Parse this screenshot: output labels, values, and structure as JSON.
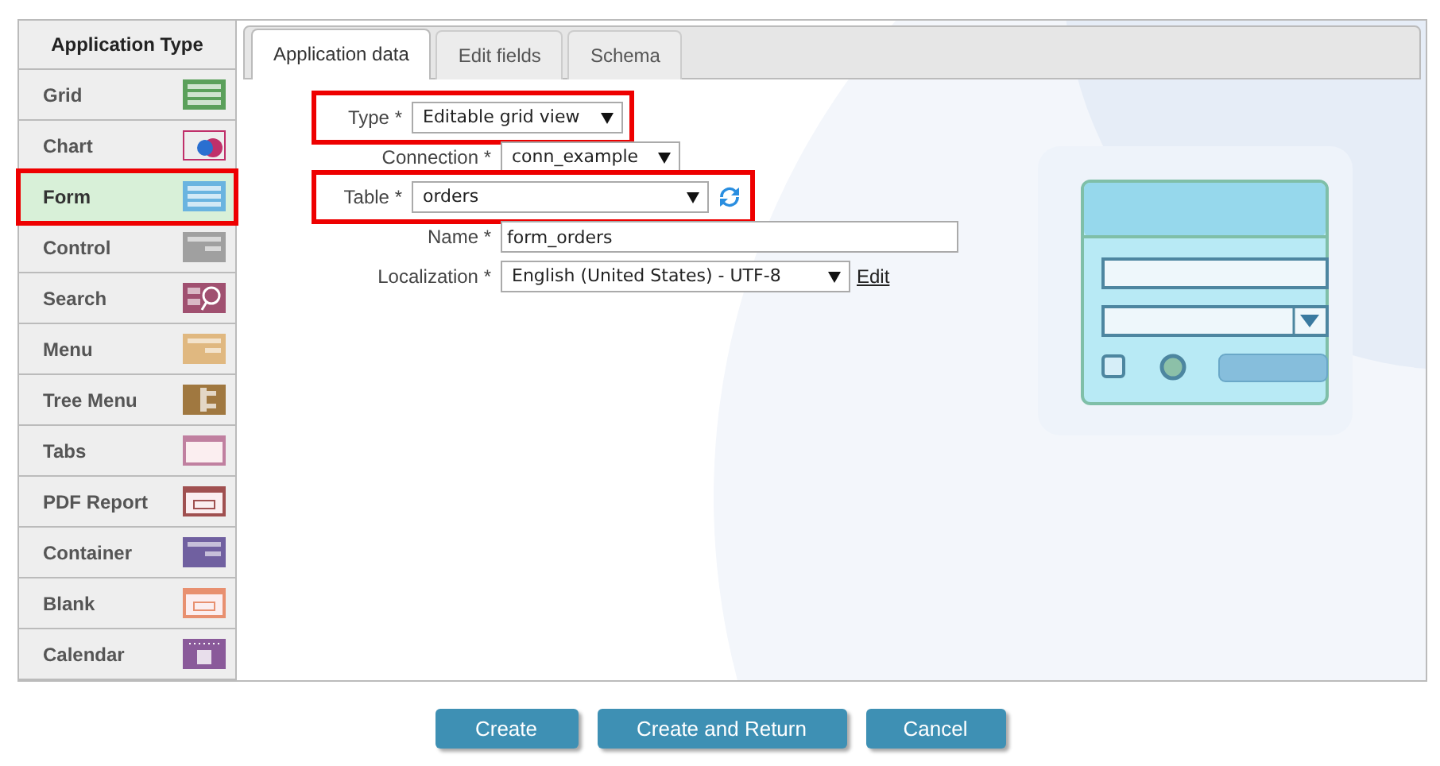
{
  "sidebar": {
    "title": "Application Type",
    "items": [
      {
        "label": "Grid",
        "selected": false,
        "highlighted": false,
        "color": "#5aa05a"
      },
      {
        "label": "Chart",
        "selected": false,
        "highlighted": false,
        "color": "#c0306a"
      },
      {
        "label": "Form",
        "selected": true,
        "highlighted": true,
        "color": "#6ab4e0"
      },
      {
        "label": "Control",
        "selected": false,
        "highlighted": false,
        "color": "#a0a0a0"
      },
      {
        "label": "Search",
        "selected": false,
        "highlighted": false,
        "color": "#a05070"
      },
      {
        "label": "Menu",
        "selected": false,
        "highlighted": false,
        "color": "#e0b880"
      },
      {
        "label": "Tree Menu",
        "selected": false,
        "highlighted": false,
        "color": "#a07840"
      },
      {
        "label": "Tabs",
        "selected": false,
        "highlighted": false,
        "color": "#c080a0"
      },
      {
        "label": "PDF Report",
        "selected": false,
        "highlighted": false,
        "color": "#a05050"
      },
      {
        "label": "Container",
        "selected": false,
        "highlighted": false,
        "color": "#7060a0"
      },
      {
        "label": "Blank",
        "selected": false,
        "highlighted": false,
        "color": "#e89070"
      },
      {
        "label": "Calendar",
        "selected": false,
        "highlighted": false,
        "color": "#8a5a9a"
      }
    ]
  },
  "tabs": [
    {
      "label": "Application data",
      "selected": true
    },
    {
      "label": "Edit fields",
      "selected": false
    },
    {
      "label": "Schema",
      "selected": false
    }
  ],
  "fields": [
    {
      "label": "Type *",
      "kind": "select",
      "value": "Editable grid view",
      "highlighted": true
    },
    {
      "label": "Connection *",
      "kind": "select",
      "value": "conn_example",
      "highlighted": false
    },
    {
      "label": "Table *",
      "kind": "select",
      "value": "orders",
      "highlighted": true,
      "refresh": true
    },
    {
      "label": "Name *",
      "kind": "text",
      "value": "form_orders",
      "highlighted": false
    },
    {
      "label": "Localization *",
      "kind": "select",
      "value": "English (United States) - UTF-8",
      "highlighted": false,
      "link": "Edit"
    }
  ],
  "buttons": [
    "Create",
    "Create and Return",
    "Cancel"
  ]
}
